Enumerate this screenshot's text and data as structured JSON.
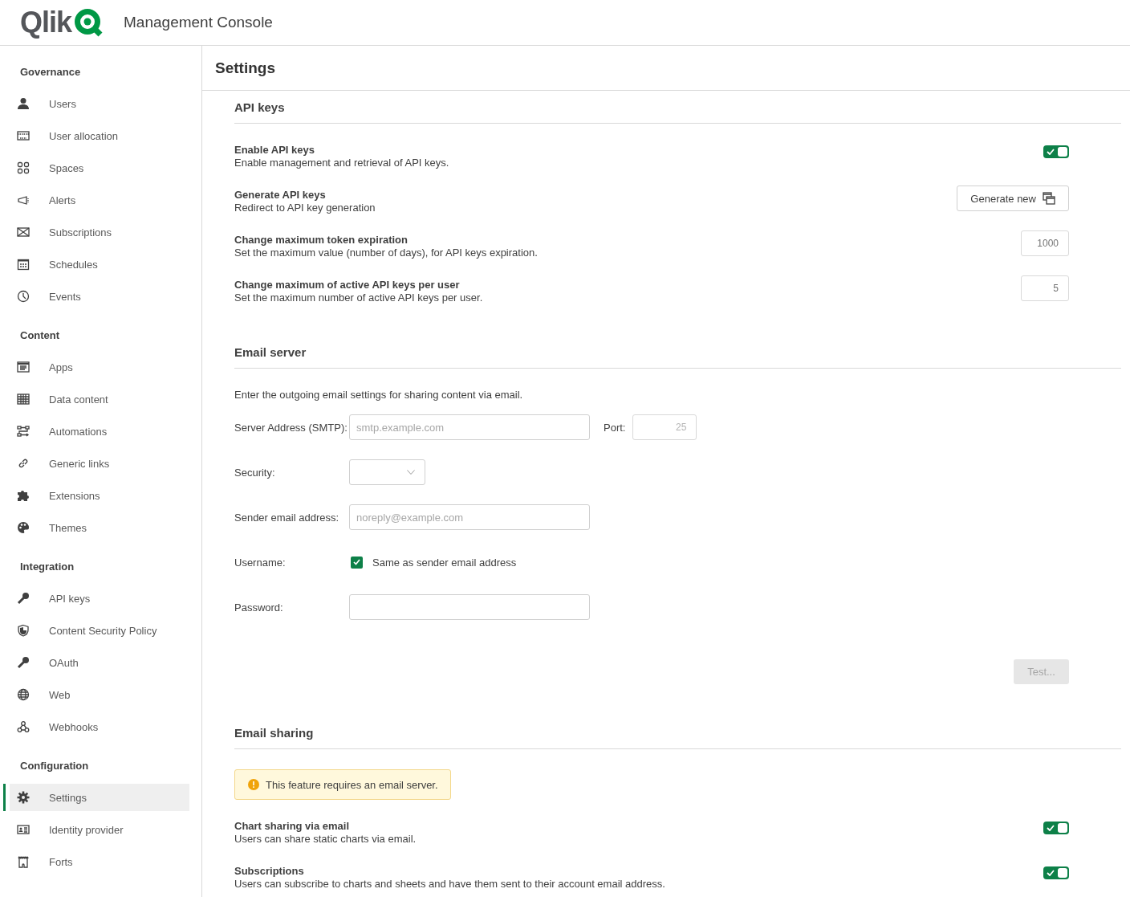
{
  "header": {
    "logo_text": "Qlik",
    "title": "Management Console"
  },
  "sidebar": {
    "sections": [
      {
        "heading": "Governance",
        "items": [
          {
            "label": "Users",
            "selected": false
          },
          {
            "label": "User allocation",
            "selected": false
          },
          {
            "label": "Spaces",
            "selected": false
          },
          {
            "label": "Alerts",
            "selected": false
          },
          {
            "label": "Subscriptions",
            "selected": false
          },
          {
            "label": "Schedules",
            "selected": false
          },
          {
            "label": "Events",
            "selected": false
          }
        ]
      },
      {
        "heading": "Content",
        "items": [
          {
            "label": "Apps",
            "selected": false
          },
          {
            "label": "Data content",
            "selected": false
          },
          {
            "label": "Automations",
            "selected": false
          },
          {
            "label": "Generic links",
            "selected": false
          },
          {
            "label": "Extensions",
            "selected": false
          },
          {
            "label": "Themes",
            "selected": false
          }
        ]
      },
      {
        "heading": "Integration",
        "items": [
          {
            "label": "API keys",
            "selected": false
          },
          {
            "label": "Content Security Policy",
            "selected": false
          },
          {
            "label": "OAuth",
            "selected": false
          },
          {
            "label": "Web",
            "selected": false
          },
          {
            "label": "Webhooks",
            "selected": false
          }
        ]
      },
      {
        "heading": "Configuration",
        "items": [
          {
            "label": "Settings",
            "selected": true
          },
          {
            "label": "Identity provider",
            "selected": false
          },
          {
            "label": "Forts",
            "selected": false
          }
        ]
      }
    ]
  },
  "page": {
    "title": "Settings"
  },
  "sections": [
    {
      "heading": "API keys",
      "rows": [
        {
          "kind": "toggle",
          "title": "Enable API keys",
          "description": "Enable management and retrieval of API keys.",
          "on": true
        },
        {
          "kind": "button",
          "title": "Generate API keys",
          "description": "Redirect to API key generation",
          "button": "Generate new"
        },
        {
          "kind": "number",
          "title": "Change maximum token expiration",
          "description": "Set the maximum value (number of days), for API keys expiration.",
          "value": "1000"
        },
        {
          "kind": "number",
          "title": "Change maximum of active API keys per user",
          "description": "Set the maximum number of active API keys per user.",
          "value": "5"
        }
      ]
    },
    {
      "heading": "Email server",
      "intro": "Enter the outgoing email settings for sharing content via email.",
      "fields": [
        {
          "kind": "text",
          "label": "Server Address (SMTP):",
          "placeholder": "smtp.example.com",
          "port": {
            "label": "Port:",
            "placeholder": "25"
          }
        },
        {
          "kind": "select",
          "label": "Security:"
        },
        {
          "kind": "text",
          "label": "Sender email address:",
          "placeholder": "noreply@example.com"
        },
        {
          "kind": "checkbox",
          "label": "Username:",
          "option": "Same as sender email address",
          "checked": true
        },
        {
          "kind": "password",
          "label": "Password:"
        }
      ],
      "test_button": {
        "label": "Test...",
        "disabled": true
      }
    },
    {
      "heading": "Email sharing",
      "notice": "This feature requires an email server.",
      "rows": [
        {
          "kind": "toggle",
          "title": "Chart sharing via email",
          "description": "Users can share static charts via email.",
          "on": true
        },
        {
          "kind": "toggle",
          "title": "Subscriptions",
          "description": "Users can subscribe to charts and sheets and have them sent to their account email address.",
          "on": true
        }
      ]
    }
  ]
}
